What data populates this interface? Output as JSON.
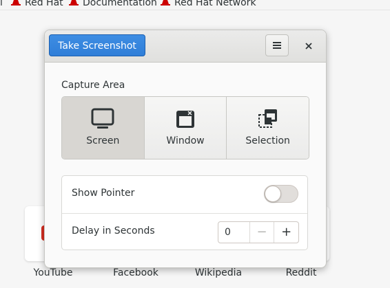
{
  "bookmarks": [
    {
      "label": "Red Hat"
    },
    {
      "label": "Documentation"
    },
    {
      "label": "Red Hat Network"
    }
  ],
  "top_sites": [
    "YouTube",
    "Facebook",
    "Wikipedia",
    "Reddit"
  ],
  "dialog": {
    "take_screenshot_label": "Take Screenshot",
    "menu_icon": "hamburger-menu-icon",
    "close_icon": "close-icon",
    "capture_area_label": "Capture Area",
    "areas": [
      {
        "label": "Screen",
        "icon": "screen-icon",
        "selected": true
      },
      {
        "label": "Window",
        "icon": "window-icon",
        "selected": false
      },
      {
        "label": "Selection",
        "icon": "selection-icon",
        "selected": false
      }
    ],
    "show_pointer_label": "Show Pointer",
    "show_pointer_on": false,
    "delay_label": "Delay in Seconds",
    "delay_value": "0",
    "minus_glyph": "−",
    "plus_glyph": "+"
  },
  "colors": {
    "accent": "#3584e4",
    "redhat": "#cc0000"
  }
}
